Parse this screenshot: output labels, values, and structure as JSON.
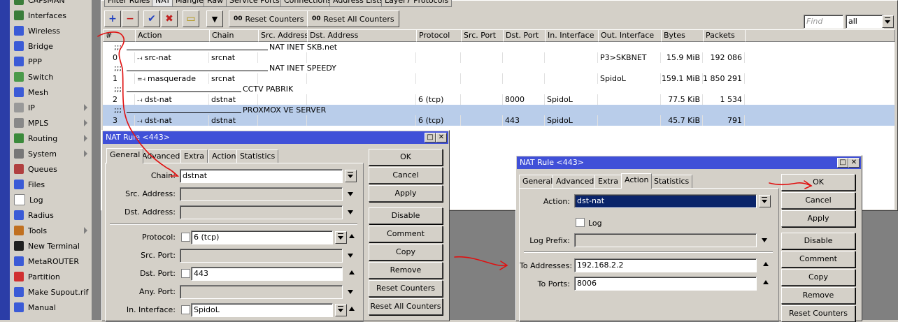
{
  "sidebar": {
    "items": [
      {
        "label": "CAPsMAN",
        "icon": "capsman-icon",
        "color": "#3a7d3a"
      },
      {
        "label": "Interfaces",
        "icon": "interfaces-icon",
        "color": "#3a7d3a"
      },
      {
        "label": "Wireless",
        "icon": "wireless-icon",
        "color": "#3b5bd6"
      },
      {
        "label": "Bridge",
        "icon": "bridge-icon",
        "color": "#3b5bd6"
      },
      {
        "label": "PPP",
        "icon": "ppp-icon",
        "color": "#3b5bd6"
      },
      {
        "label": "Switch",
        "icon": "switch-icon",
        "color": "#4a9a4a"
      },
      {
        "label": "Mesh",
        "icon": "mesh-icon",
        "color": "#3b5bd6"
      },
      {
        "label": "IP",
        "icon": "ip-icon",
        "color": "#999999",
        "arrow": true
      },
      {
        "label": "MPLS",
        "icon": "mpls-icon",
        "color": "#888888",
        "arrow": true
      },
      {
        "label": "Routing",
        "icon": "routing-icon",
        "color": "#3b8a3b",
        "arrow": true
      },
      {
        "label": "System",
        "icon": "system-icon",
        "color": "#777777",
        "arrow": true
      },
      {
        "label": "Queues",
        "icon": "queues-icon",
        "color": "#b04040"
      },
      {
        "label": "Files",
        "icon": "files-icon",
        "color": "#3b5bd6"
      },
      {
        "label": "Log",
        "icon": "log-icon",
        "color": "#ffffff"
      },
      {
        "label": "Radius",
        "icon": "radius-icon",
        "color": "#3b5bd6"
      },
      {
        "label": "Tools",
        "icon": "tools-icon",
        "color": "#c07020",
        "arrow": true
      },
      {
        "label": "New Terminal",
        "icon": "terminal-icon",
        "color": "#202020"
      },
      {
        "label": "MetaROUTER",
        "icon": "metarouter-icon",
        "color": "#3b5bd6"
      },
      {
        "label": "Partition",
        "icon": "partition-icon",
        "color": "#d03030"
      },
      {
        "label": "Make Supout.rif",
        "icon": "supout-icon",
        "color": "#3b5bd6"
      },
      {
        "label": "Manual",
        "icon": "manual-icon",
        "color": "#3b5bd6"
      }
    ]
  },
  "main": {
    "tabs": [
      "Filter Rules",
      "NAT",
      "Mangle",
      "Raw",
      "Service Ports",
      "Connections",
      "Address Lists",
      "Layer7 Protocols"
    ],
    "toolbar": {
      "add": "+",
      "remove": "−",
      "enable": "✔",
      "disable": "✖",
      "comment": "▭",
      "filter": "▼",
      "reset_counters": "Reset Counters",
      "reset_all_counters": "Reset All Counters",
      "reset_counters_prefix": "00",
      "reset_all_prefix": "00",
      "find_placeholder": "Find",
      "filter_value": "all"
    },
    "columns": [
      "#",
      "Action",
      "Chain",
      "Src. Address",
      "Dst. Address",
      "Protocol",
      "Src. Port",
      "Dst. Port",
      "In. Interface",
      "Out. Interface",
      "Bytes",
      "Packets"
    ],
    "rows": [
      {
        "type": "comment",
        "text": "NAT INET SKB.net",
        "marker": ";;;"
      },
      {
        "type": "rule",
        "num": "0",
        "action": "src-nat",
        "chain": "srcnat",
        "src": "",
        "dst": "",
        "proto": "",
        "sport": "",
        "dport": "",
        "in": "",
        "out": "P3>SKBNET",
        "bytes": "15.9 MiB",
        "packets": "192 086",
        "icon": "-⫞"
      },
      {
        "type": "comment",
        "text": "NAT INET SPEEDY",
        "marker": ";;;"
      },
      {
        "type": "rule",
        "num": "1",
        "action": "masquerade",
        "chain": "srcnat",
        "src": "",
        "dst": "",
        "proto": "",
        "sport": "",
        "dport": "",
        "in": "",
        "out": "SpidoL",
        "bytes": "159.1 MiB",
        "packets": "1 850 291",
        "icon": "=⫞"
      },
      {
        "type": "comment",
        "text": "CCTV PABRIK",
        "marker": ";;;"
      },
      {
        "type": "rule",
        "num": "2",
        "action": "dst-nat",
        "chain": "dstnat",
        "src": "",
        "dst": "",
        "proto": "6 (tcp)",
        "sport": "",
        "dport": "8000",
        "in": "SpidoL",
        "out": "",
        "bytes": "77.5 KiB",
        "packets": "1 534",
        "icon": "-⫞"
      },
      {
        "type": "comment",
        "text": "PROXMOX VE SERVER",
        "marker": ";;;",
        "selected": true
      },
      {
        "type": "rule",
        "num": "3",
        "action": "dst-nat",
        "chain": "dstnat",
        "src": "",
        "dst": "",
        "proto": "6 (tcp)",
        "sport": "",
        "dport": "443",
        "in": "SpidoL",
        "out": "",
        "bytes": "45.7 KiB",
        "packets": "791",
        "icon": "-⫞",
        "selected": true
      }
    ]
  },
  "dialog1": {
    "title": "NAT Rule <443>",
    "tabs": [
      "General",
      "Advanced",
      "Extra",
      "Action",
      "Statistics"
    ],
    "fields": {
      "chain_label": "Chain:",
      "chain_value": "dstnat",
      "src_label": "Src. Address:",
      "dst_label": "Dst. Address:",
      "proto_label": "Protocol:",
      "proto_value": "6 (tcp)",
      "sport_label": "Src. Port:",
      "dport_label": "Dst. Port:",
      "dport_value": "443",
      "anyport_label": "Any. Port:",
      "inif_label": "In. Interface:",
      "inif_value": "SpidoL"
    },
    "buttons": [
      "OK",
      "Cancel",
      "Apply",
      "Disable",
      "Comment",
      "Copy",
      "Remove",
      "Reset Counters",
      "Reset All Counters"
    ]
  },
  "dialog2": {
    "title": "NAT Rule <443>",
    "tabs": [
      "General",
      "Advanced",
      "Extra",
      "Action",
      "Statistics"
    ],
    "fields": {
      "action_label": "Action:",
      "action_value": "dst-nat",
      "log_label": "Log",
      "logprefix_label": "Log Prefix:",
      "toaddr_label": "To Addresses:",
      "toaddr_value": "192.168.2.2",
      "toports_label": "To Ports:",
      "toports_value": "8006"
    },
    "buttons": [
      "OK",
      "Cancel",
      "Apply",
      "Disable",
      "Comment",
      "Copy",
      "Remove",
      "Reset Counters"
    ]
  },
  "colors": {
    "accent": "#4050d8",
    "annotation": "#e01010",
    "selection": "#b9cdea"
  }
}
